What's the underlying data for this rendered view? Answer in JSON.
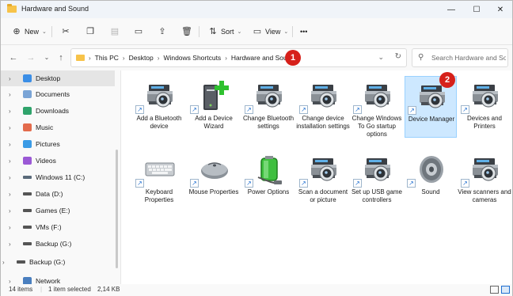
{
  "window": {
    "title": "Hardware and Sound"
  },
  "titlebar_controls": {
    "minimize": "—",
    "maximize": "☐",
    "close": "✕"
  },
  "toolbar": {
    "new_label": "New",
    "sort_label": "Sort",
    "view_label": "View",
    "more_label": "•••"
  },
  "address": {
    "crumbs": [
      "This PC",
      "Desktop",
      "Windows Shortcuts",
      "Hardware and Sound"
    ],
    "search_placeholder": "Search Hardware and So..."
  },
  "sidebar": {
    "items": [
      {
        "label": "Desktop",
        "icon": "desktop-icon",
        "color": "#3b8ee6"
      },
      {
        "label": "Documents",
        "icon": "documents-icon",
        "color": "#7aa4d6"
      },
      {
        "label": "Downloads",
        "icon": "downloads-icon",
        "color": "#2fa36b"
      },
      {
        "label": "Music",
        "icon": "music-icon",
        "color": "#e36b4c"
      },
      {
        "label": "Pictures",
        "icon": "pictures-icon",
        "color": "#3b9be6"
      },
      {
        "label": "Videos",
        "icon": "videos-icon",
        "color": "#9b59d6"
      },
      {
        "label": "Windows 11 (C:)",
        "icon": "drive-icon",
        "color": "#5a6a7a"
      },
      {
        "label": "Data (D:)",
        "icon": "drive-icon",
        "color": "#555555"
      },
      {
        "label": "Games (E:)",
        "icon": "drive-icon",
        "color": "#555555"
      },
      {
        "label": "VMs (F:)",
        "icon": "drive-icon",
        "color": "#555555"
      },
      {
        "label": "Backup (G:)",
        "icon": "drive-icon",
        "color": "#555555"
      },
      {
        "label": "Backup (G:)",
        "icon": "drive-icon",
        "color": "#555555"
      },
      {
        "label": "Network",
        "icon": "network-icon",
        "color": "#4a7fbf"
      }
    ]
  },
  "items": [
    {
      "label": "Add a Bluetooth device",
      "icon": "printer-camera-icon"
    },
    {
      "label": "Add a Device Wizard",
      "icon": "device-wizard-icon"
    },
    {
      "label": "Change Bluetooth settings",
      "icon": "printer-camera-icon"
    },
    {
      "label": "Change device installation settings",
      "icon": "printer-camera-icon"
    },
    {
      "label": "Change Windows To Go startup options",
      "icon": "printer-camera-icon"
    },
    {
      "label": "Device Manager",
      "icon": "printer-camera-icon"
    },
    {
      "label": "Devices and Printers",
      "icon": "printer-camera-icon"
    },
    {
      "label": "Keyboard Properties",
      "icon": "keyboard-icon"
    },
    {
      "label": "Mouse Properties",
      "icon": "mouse-icon"
    },
    {
      "label": "Power Options",
      "icon": "battery-icon"
    },
    {
      "label": "Scan a document or picture",
      "icon": "printer-camera-icon"
    },
    {
      "label": "Set up USB game controllers",
      "icon": "printer-camera-icon"
    },
    {
      "label": "Sound",
      "icon": "speaker-icon"
    },
    {
      "label": "View scanners and cameras",
      "icon": "printer-camera-icon"
    }
  ],
  "badges": {
    "one": "1",
    "two": "2"
  },
  "status": {
    "count": "14 items",
    "selection": "1 item selected",
    "size": "2,14 KB"
  }
}
